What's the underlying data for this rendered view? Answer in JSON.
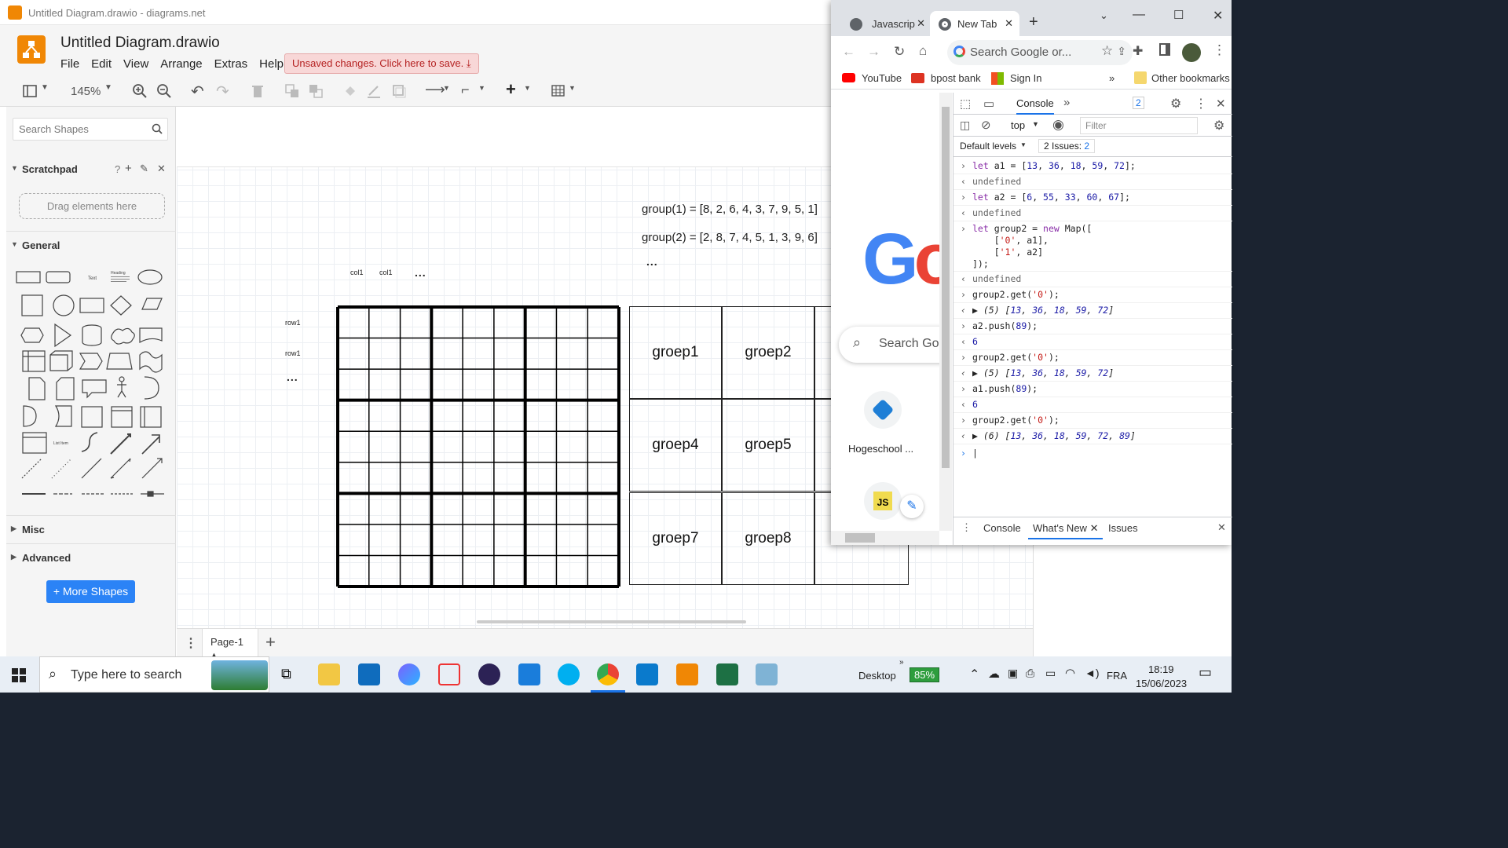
{
  "drawio": {
    "window_title": "Untitled Diagram.drawio - diagrams.net",
    "doc_title": "Untitled Diagram.drawio",
    "menu": [
      "File",
      "Edit",
      "View",
      "Arrange",
      "Extras",
      "Help"
    ],
    "unsaved_label": "Unsaved changes. Click here to save.",
    "zoom": "145%",
    "search_placeholder": "Search Shapes",
    "scratchpad_label": "Scratchpad",
    "scratchpad_help": "?",
    "drag_label": "Drag elements here",
    "general_label": "General",
    "misc_label": "Misc",
    "advanced_label": "Advanced",
    "more_shapes_label": "More Shapes",
    "page_tab": "Page-1",
    "canvas": {
      "group1_text": "group(1) = [8, 2, 6, 4, 3, 7, 9, 5, 1]",
      "group2_text": "group(2) = [2, 8, 7, 4, 5, 1, 3, 9, 6]",
      "top_ellipsis": "...",
      "col_labels": [
        "col1",
        "col1"
      ],
      "col_ellipsis": "...",
      "row_labels": [
        "row1",
        "row1"
      ],
      "row_ellipsis": "...",
      "groups": [
        "groep1",
        "groep2",
        "groep4",
        "groep5",
        "groep7",
        "groep8"
      ]
    }
  },
  "chrome": {
    "tabs": [
      {
        "label": "Javascrip",
        "active": false
      },
      {
        "label": "New Tab",
        "active": true
      }
    ],
    "omnibox": "Search Google or...",
    "bookmarks": [
      "YouTube",
      "bpost bank",
      "Sign In"
    ],
    "bookmarks_more": "»",
    "other_bookmarks": "Other bookmarks",
    "page": {
      "search_placeholder": "Search Go",
      "shortcut1_label": "Hogeschool ...",
      "shortcut2_glyph": "JS"
    }
  },
  "devtools": {
    "tab_console": "Console",
    "issues_count_badge": "2",
    "context": "top",
    "filter_placeholder": "Filter",
    "levels": "Default levels",
    "issues_label": "2 Issues:",
    "issues_badge": "2",
    "drawer_tabs": [
      "Console",
      "What's New",
      "Issues"
    ]
  },
  "taskbar": {
    "search_placeholder": "Type here to search",
    "desktop_label": "Desktop",
    "battery": "85%",
    "language": "FRA",
    "time": "18:19",
    "date": "15/06/2023"
  },
  "colors": {
    "drawio_accent": "#f08705",
    "button_blue": "#2b83f6",
    "unsaved_red": "#b52222"
  }
}
